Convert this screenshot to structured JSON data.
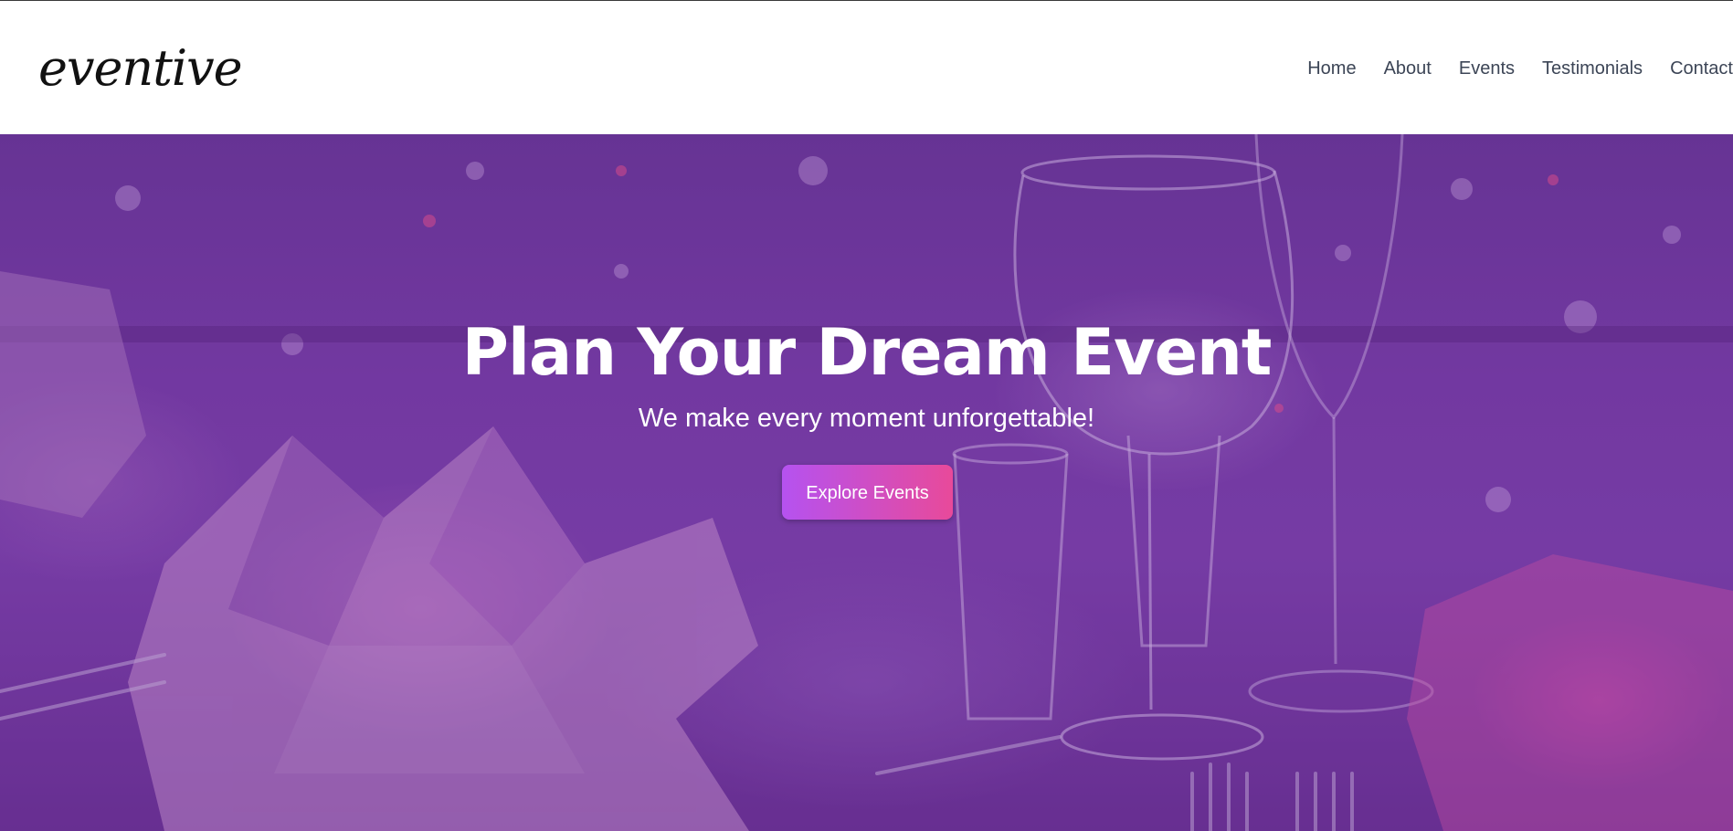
{
  "header": {
    "logo": "eventive",
    "nav": [
      "Home",
      "About",
      "Events",
      "Testimonials",
      "Contact"
    ]
  },
  "hero": {
    "title": "Plan Your Dream Event",
    "subtitle": "We make every moment unforgettable!",
    "cta_label": "Explore Events"
  },
  "colors": {
    "nav_text": "#3c4556",
    "cta_gradient_start": "#b552f0",
    "cta_gradient_end": "#e84a9a",
    "hero_tint": "#7a41a8"
  }
}
